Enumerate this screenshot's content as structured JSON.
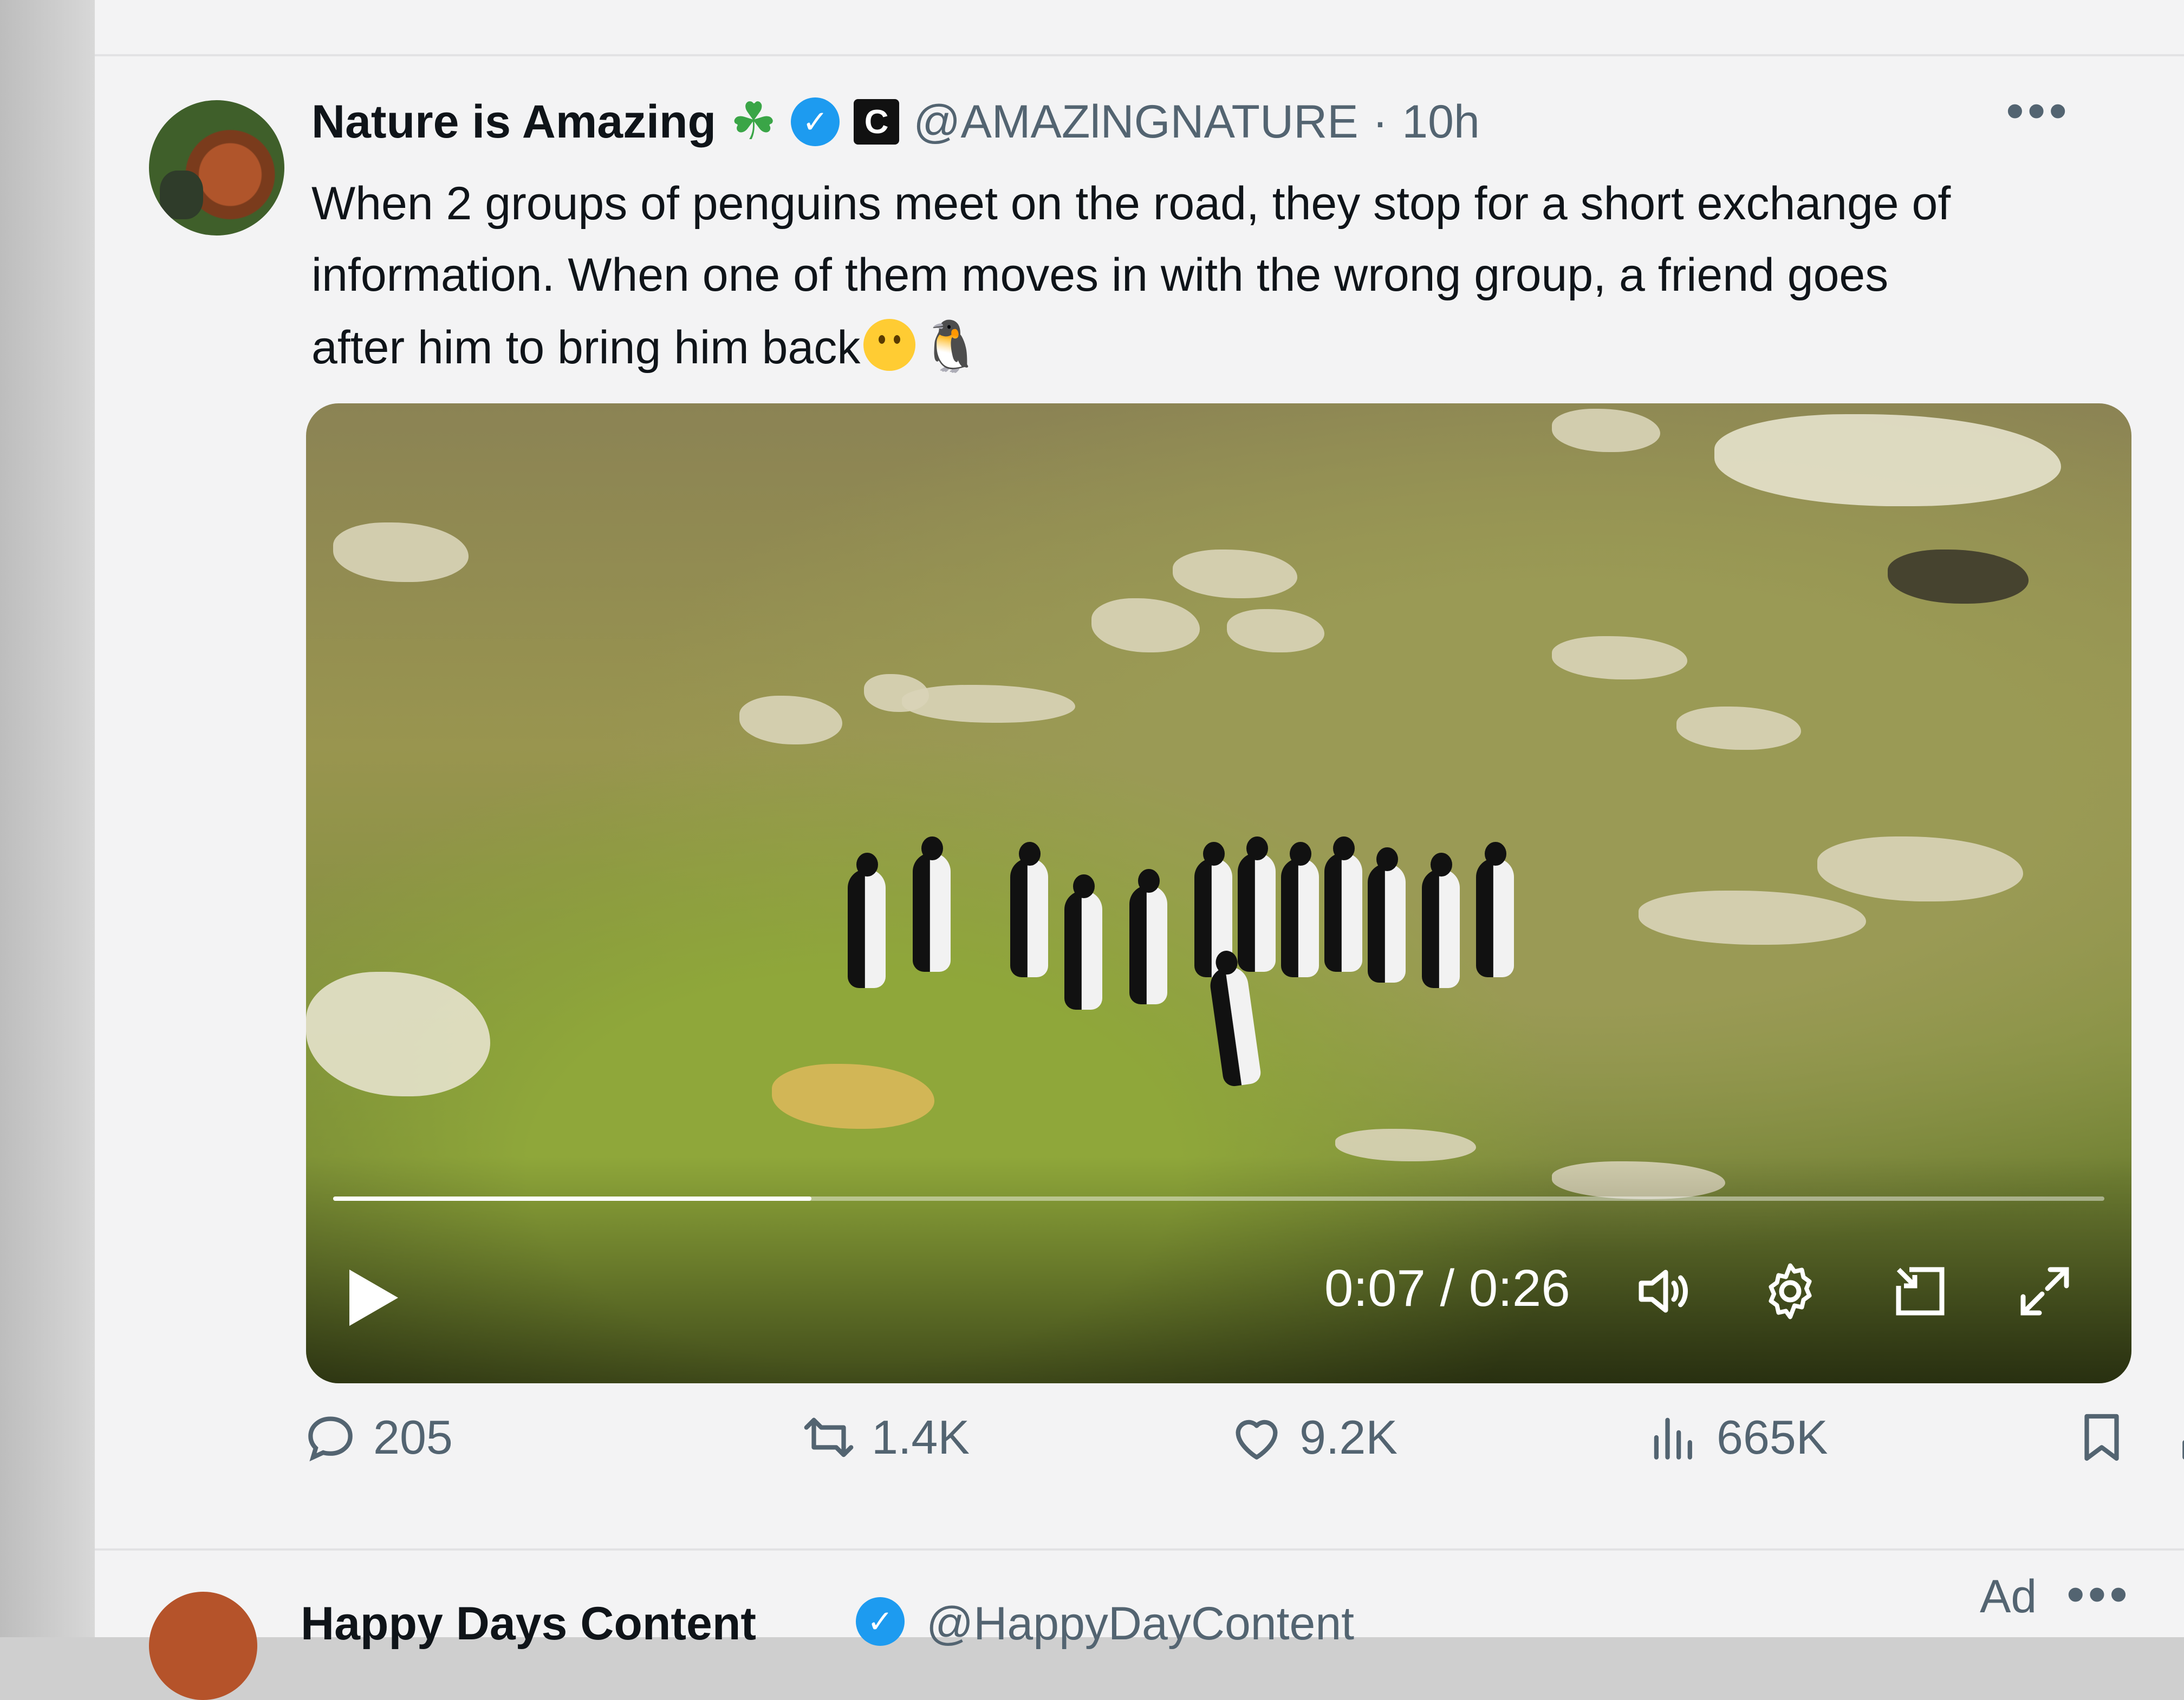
{
  "tweet": {
    "author_name": "Nature is Amazing",
    "name_emoji": "☘",
    "handle": "@AMAZlNGNATURE",
    "separator": "·",
    "time": "10h",
    "more": "•••",
    "text": "When 2 groups of penguins meet on the road, they stop for a short exchange of information.  When one of them moves in with the wrong group, a friend goes after him to bring him back",
    "emoji_penguin": "🐧",
    "badge_letter": "C"
  },
  "video": {
    "current_time": "0:07",
    "separator": " / ",
    "duration": "0:26",
    "progress": 0.27
  },
  "actions": {
    "replies": "205",
    "reposts": "1.4K",
    "likes": "9.2K",
    "views": "665K"
  },
  "next_tweet": {
    "author_name": "Happy Days Content",
    "handle": "@HappyDayContent",
    "ad_label": "Ad",
    "more": "•••"
  },
  "colors": {
    "accent": "#1d9bf0",
    "text_primary": "#0f1419",
    "text_secondary": "#536471"
  }
}
